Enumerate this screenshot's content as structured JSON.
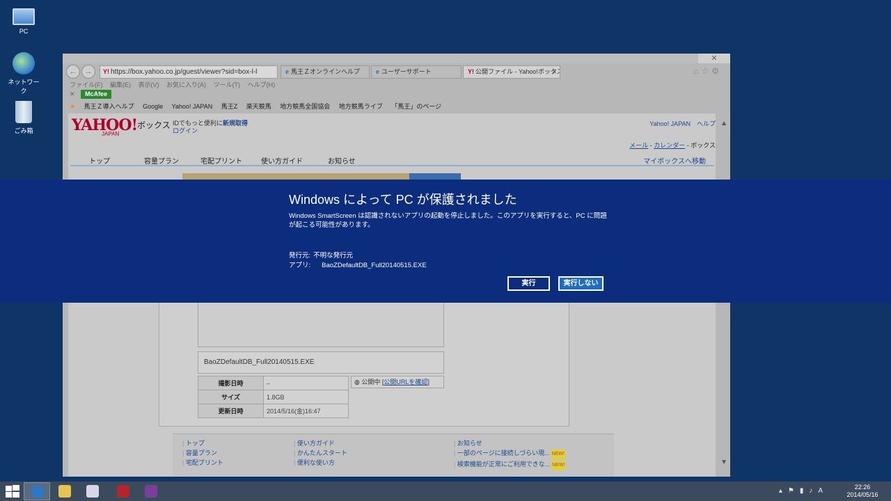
{
  "desktop": {
    "icons": [
      {
        "label": "PC"
      },
      {
        "label": "ネットワーク"
      },
      {
        "label": "ごみ箱"
      }
    ]
  },
  "browser": {
    "address": "https://box.yahoo.co.jp/guest/viewer?sid=box-l-l",
    "tabs": [
      {
        "label": "馬王Ｚオンラインヘルプ"
      },
      {
        "label": "ユーザーサポート"
      },
      {
        "label": "公開ファイル - Yahoo!ボックス"
      }
    ],
    "menu": [
      "ファイル(F)",
      "編集(E)",
      "表示(V)",
      "お気に入り(A)",
      "ツール(T)",
      "ヘルプ(H)"
    ],
    "toolbar": {
      "mcafee": "McAfee"
    },
    "favorites": [
      "馬王Ｚ導入ヘルプ",
      "Google",
      "Yahoo! JAPAN",
      "馬王Z",
      "楽天競馬",
      "地方競馬全国協会",
      "地方競馬ライブ",
      "「馬王」のページ"
    ]
  },
  "page": {
    "logo": "YAHOO!",
    "logo_sub": "JAPAN",
    "service": "ボックス",
    "id_text": "IDでもっと便利に",
    "id_link": "新規取得",
    "login": "ログイン",
    "top_right": "Yahoo! JAPAN　ヘルプ",
    "breadcrumb": {
      "mail": "メール",
      "sep": " - ",
      "calendar": "カレンダー",
      "current": " - ボックス"
    },
    "nav": [
      "トップ",
      "容量プラン",
      "宅配プリント",
      "使い方ガイド",
      "お知らせ"
    ],
    "nav_right": "マイボックスへ移動",
    "filename": "BaoZDefaultDB_Full20140515.EXE",
    "info": [
      {
        "key": "撮影日時",
        "value": "–"
      },
      {
        "key": "サイズ",
        "value": "1.8GB"
      },
      {
        "key": "更新日時",
        "value": "2014/5/16(金)16:47"
      }
    ],
    "public_status": "公開中 [",
    "public_link": "公開URLを確認",
    "public_end": "]",
    "footer": {
      "col1": [
        "トップ",
        "容量プラン",
        "宅配プリント"
      ],
      "col2_title": "使い方ガイド",
      "col2": [
        "かんたんスタート",
        "便利な使い方"
      ],
      "col3_title": "お知らせ",
      "col3": [
        "一部のページに接続しづらい現...",
        "検索機能が正常にご利用できな..."
      ],
      "new_badge": "NEW!"
    }
  },
  "smartscreen": {
    "title": "Windows によって PC が保護されました",
    "message": "Windows SmartScreen は認識されないアプリの起動を停止しました。このアプリを実行すると、PC に問題が起こる可能性があります。",
    "publisher_label": "発行元:",
    "publisher_value": "不明な発行元",
    "app_label": "アプリ:",
    "app_value": "BaoZDefaultDB_Full20140515.EXE",
    "run_button": "実行",
    "dont_run_button": "実行しない"
  },
  "taskbar": {
    "time": "22:26",
    "date": "2014/05/16"
  }
}
